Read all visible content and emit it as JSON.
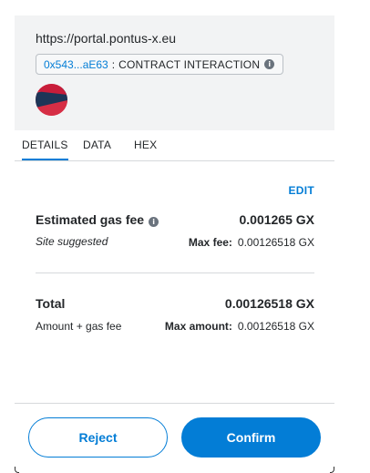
{
  "header": {
    "origin": "https://portal.pontus-x.eu",
    "address_short": "0x543...aE63",
    "separator": ":",
    "contract_type": "CONTRACT INTERACTION"
  },
  "tabs": [
    {
      "label": "DETAILS",
      "active": true
    },
    {
      "label": "DATA",
      "active": false
    },
    {
      "label": "HEX",
      "active": false
    }
  ],
  "edit_label": "EDIT",
  "gas": {
    "label": "Estimated gas fee",
    "sublabel": "Site suggested",
    "value": "0.001265 GX",
    "max_fee_label": "Max fee:",
    "max_fee_value": "0.00126518 GX"
  },
  "total": {
    "label": "Total",
    "sublabel": "Amount + gas fee",
    "value": "0.00126518 GX",
    "max_amount_label": "Max amount:",
    "max_amount_value": "0.00126518 GX"
  },
  "buttons": {
    "reject": "Reject",
    "confirm": "Confirm"
  },
  "colors": {
    "accent": "#037dd6",
    "header_bg": "#f2f3f4"
  }
}
